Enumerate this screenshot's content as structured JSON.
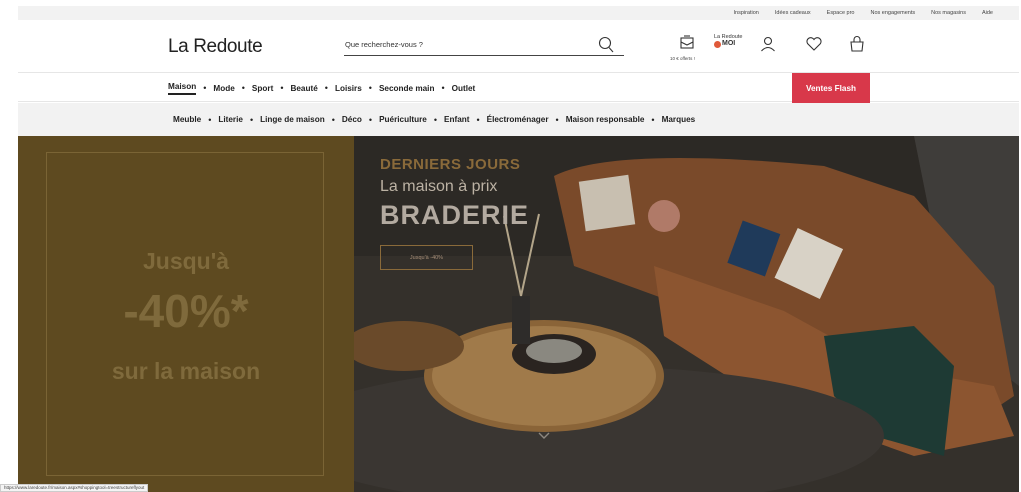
{
  "util_links": [
    "Inspiration",
    "Idées cadeaux",
    "Espace pro",
    "Nos engagements",
    "Nos magasins",
    "Aide"
  ],
  "header": {
    "logo": "La Redoute",
    "search_placeholder": "Que recherchez-vous ?",
    "offer": "10 € offerts !",
    "lr_moi_line1": "La Redoute",
    "lr_moi_line2": "MOI"
  },
  "main_nav": {
    "items": [
      "Maison",
      "Mode",
      "Sport",
      "Beauté",
      "Loisirs",
      "Seconde main",
      "Outlet"
    ],
    "flash": "Ventes Flash"
  },
  "sub_nav": [
    "Meuble",
    "Literie",
    "Linge de maison",
    "Déco",
    "Puériculture",
    "Enfant",
    "Électroménager",
    "Maison responsable",
    "Marques"
  ],
  "promo": {
    "line1": "Jusqu'à",
    "line2": "-40%*",
    "line3": "sur la maison"
  },
  "hero": {
    "kicker": "DERNIERS JOURS",
    "subtitle": "La maison à prix",
    "title": "BRADERIE",
    "button": "Jusqu'à -40%"
  },
  "status_url": "https://www.laredoute.fr/maison.aspx#shoppingtool=treestructureflyout"
}
